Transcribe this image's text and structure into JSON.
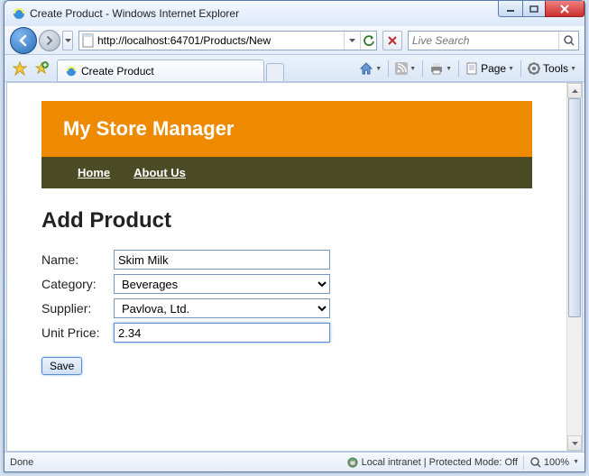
{
  "window": {
    "title": "Create Product - Windows Internet Explorer"
  },
  "nav": {
    "url": "http://localhost:64701/Products/New",
    "search_placeholder": "Live Search"
  },
  "tab": {
    "title": "Create Product"
  },
  "toolbar": {
    "page_label": "Page",
    "tools_label": "Tools"
  },
  "site": {
    "banner_title": "My Store Manager",
    "nav_links": {
      "home": "Home",
      "about": "About Us"
    }
  },
  "content": {
    "heading": "Add Product",
    "labels": {
      "name": "Name:",
      "category": "Category:",
      "supplier": "Supplier:",
      "unit_price": "Unit Price:"
    },
    "values": {
      "name": "Skim Milk",
      "category": "Beverages",
      "supplier": "Pavlova, Ltd.",
      "unit_price": "2.34"
    },
    "save_label": "Save"
  },
  "status": {
    "left": "Done",
    "zone": "Local intranet | Protected Mode: Off",
    "zoom": "100%"
  }
}
